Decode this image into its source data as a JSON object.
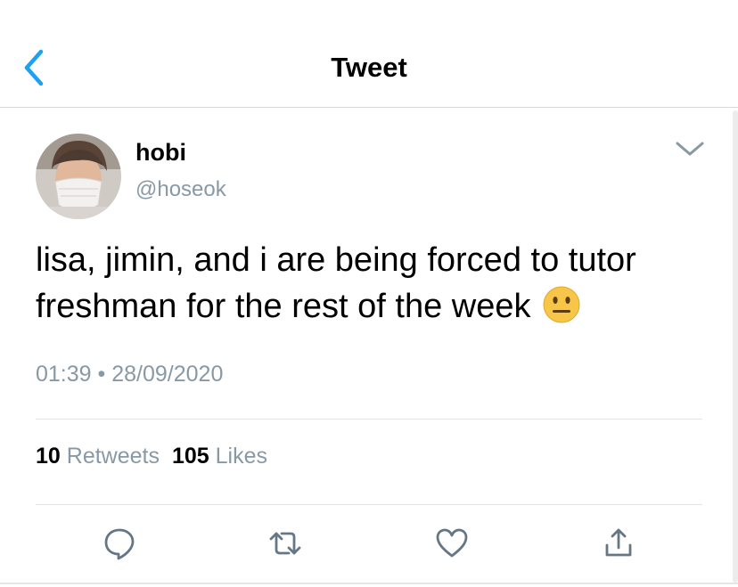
{
  "header": {
    "title": "Tweet",
    "back_icon": "chevron-left-icon",
    "accent_color": "#1da1f2"
  },
  "tweet": {
    "author": {
      "display_name": "hobi",
      "handle": "@hoseok",
      "avatar_icon": "profile-photo"
    },
    "text": "lisa, jimin, and i are being forced to tutor freshman for the rest of the week",
    "emoji_icon": "neutral-face-emoji",
    "time": "01:39",
    "separator": "•",
    "date": "28/09/2020",
    "more_icon": "chevron-down-icon"
  },
  "stats": {
    "retweets_count": "10",
    "retweets_label": "Retweets",
    "likes_count": "105",
    "likes_label": "Likes"
  },
  "actions": [
    {
      "icon": "reply-icon"
    },
    {
      "icon": "retweet-icon"
    },
    {
      "icon": "like-icon"
    },
    {
      "icon": "share-icon"
    }
  ],
  "colors": {
    "muted": "#8899a6",
    "divider": "#e1e4e6",
    "icon": "#657786"
  }
}
